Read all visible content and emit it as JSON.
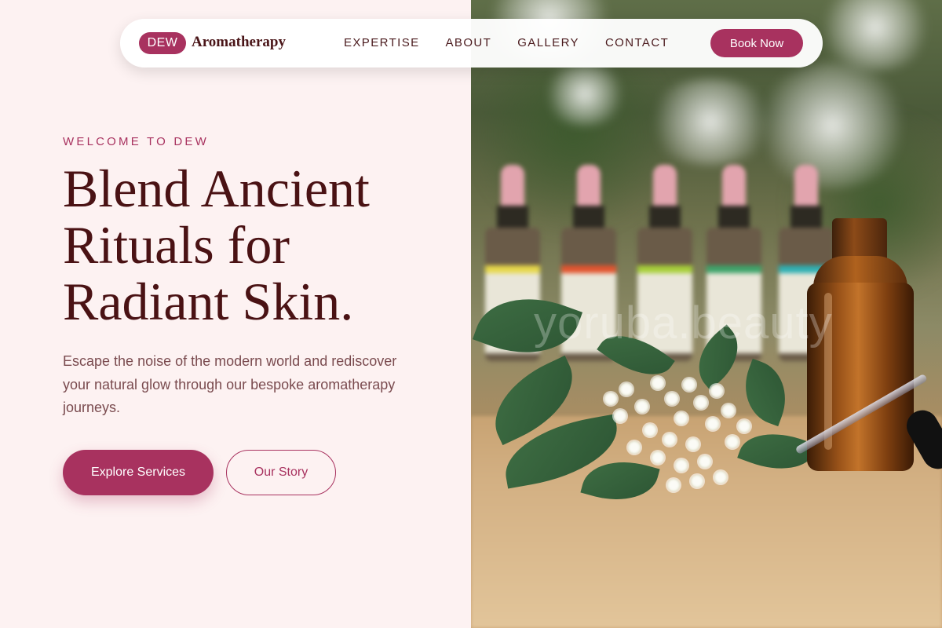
{
  "nav": {
    "brand_badge": "DEW",
    "brand_name": "Aromatherapy",
    "links": [
      {
        "label": "EXPERTISE"
      },
      {
        "label": "ABOUT"
      },
      {
        "label": "GALLERY"
      },
      {
        "label": "CONTACT"
      }
    ],
    "cta_label": "Book Now"
  },
  "hero": {
    "eyebrow": "WELCOME TO DEW",
    "headline_line1": "Blend Ancient",
    "headline_line2": "Rituals for",
    "headline_line3": "Radiant Skin.",
    "description": "Escape the noise of the modern world and rediscover your natural glow through our bespoke aromatherapy journeys.",
    "primary_button": "Explore Services",
    "secondary_button": "Our Story"
  },
  "image": {
    "subject": "essential-oil-bottles-with-white-flowers",
    "watermark": "yoruba.beauty"
  },
  "colors": {
    "accent": "#a8325f",
    "heading": "#4a1214",
    "background": "#fdf2f2"
  }
}
